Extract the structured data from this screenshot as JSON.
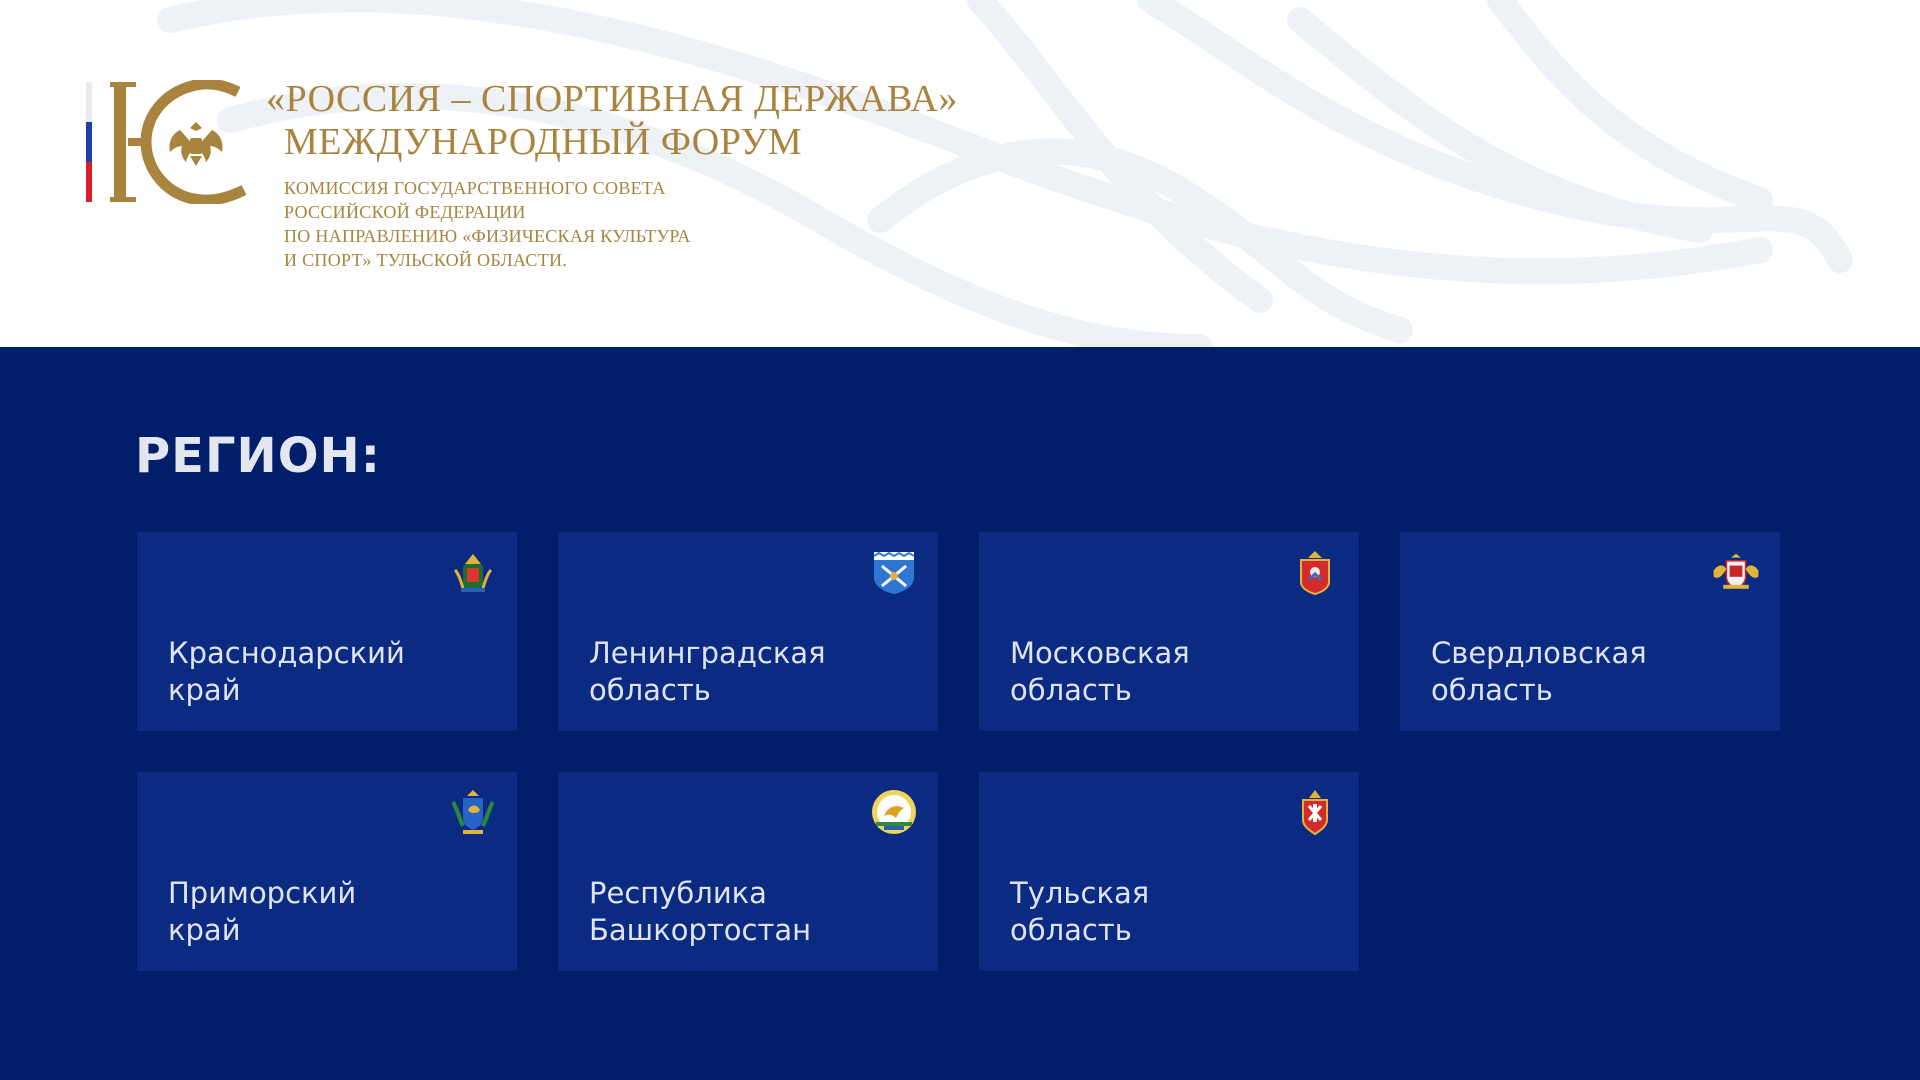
{
  "header": {
    "title_line1": "«РОССИЯ – СПОРТИВНАЯ ДЕРЖАВА»",
    "title_line2": "МЕЖДУНАРОДНЫЙ ФОРУМ",
    "commission_lines": [
      "КОМИССИЯ ГОСУДАРСТВЕННОГО СОВЕТА",
      "РОССИЙСКОЙ ФЕДЕРАЦИИ",
      "ПО НАПРАВЛЕНИЮ «ФИЗИЧЕСКАЯ КУЛЬТУРА",
      "И СПОРТ» ТУЛЬСКОЙ ОБЛАСТИ."
    ],
    "logo_letters": "КС"
  },
  "regions": {
    "heading": "РЕГИОН:",
    "items": [
      {
        "label": "Краснодарский\nкрай",
        "coat_icon": "krasnodar-coat-of-arms-icon"
      },
      {
        "label": "Ленинградская\nобласть",
        "coat_icon": "leningrad-coat-of-arms-icon"
      },
      {
        "label": "Московская\nобласть",
        "coat_icon": "moscow-oblast-coat-of-arms-icon"
      },
      {
        "label": "Свердловская\nобласть",
        "coat_icon": "sverdlovsk-coat-of-arms-icon"
      },
      {
        "label": "Приморский\nкрай",
        "coat_icon": "primorsky-coat-of-arms-icon"
      },
      {
        "label": "Республика\nБашкортостан",
        "coat_icon": "bashkortostan-coat-of-arms-icon"
      },
      {
        "label": "Тульская\nобласть",
        "coat_icon": "tula-coat-of-arms-icon"
      }
    ]
  },
  "colors": {
    "background": "#001e69",
    "card": "#0b2b83",
    "gold": "#a9843e",
    "text_light": "#dfe3ef"
  }
}
